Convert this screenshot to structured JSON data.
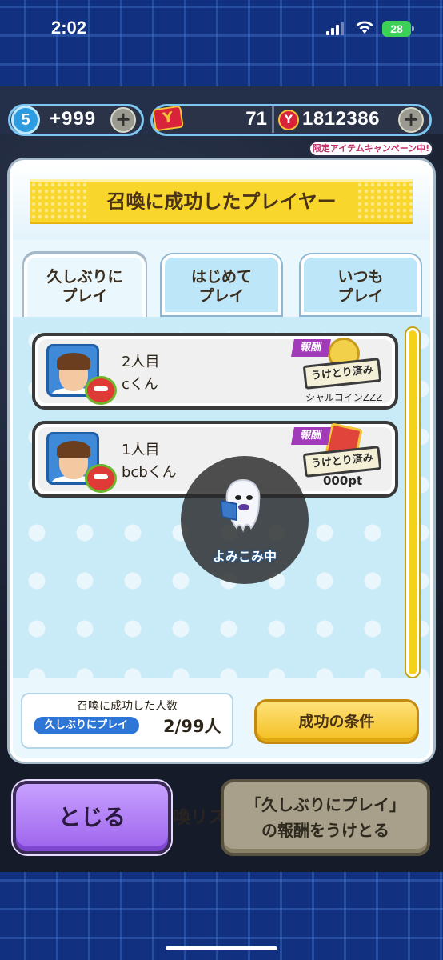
{
  "status_bar": {
    "time": "2:02",
    "battery": "28"
  },
  "currency": {
    "medal_level": "5",
    "medal_value": "+999",
    "ticket_value": "71",
    "money_value": "1812386",
    "campaign_badge": "限定アイテムキャンペーン中!"
  },
  "dialog": {
    "title": "召喚に成功したプレイヤー",
    "tabs": [
      {
        "line1": "久しぶりに",
        "line2": "プレイ",
        "active": true
      },
      {
        "line1": "はじめて",
        "line2": "プレイ",
        "active": false
      },
      {
        "line1": "いつも",
        "line2": "プレイ",
        "active": false
      }
    ],
    "rows": [
      {
        "count": "2人目",
        "name": "cくん",
        "reward_label": "報酬",
        "claimed": "うけとり済み",
        "reward_text": "シャルコインZZZ"
      },
      {
        "count": "1人目",
        "name": "bcbくん",
        "reward_label": "報酬",
        "claimed": "うけとり済み",
        "reward_text": "000pt"
      }
    ],
    "loading_text": "よみこみ中",
    "count_title": "召喚に成功した人数",
    "count_chip": "久しぶりにプレイ",
    "count_value": "2/99人",
    "conditions_button": "成功の条件"
  },
  "footer": {
    "close_button": "とじる",
    "background_label": "喚リス",
    "receive_line1": "「久しぶりにプレイ」",
    "receive_line2": "の報酬をうけとる"
  },
  "colors": {
    "banner_yellow": "#f9d62c",
    "close_purple": "#9d63ec",
    "condition_yellow": "#f3be20",
    "chip_blue": "#2d75d6"
  }
}
